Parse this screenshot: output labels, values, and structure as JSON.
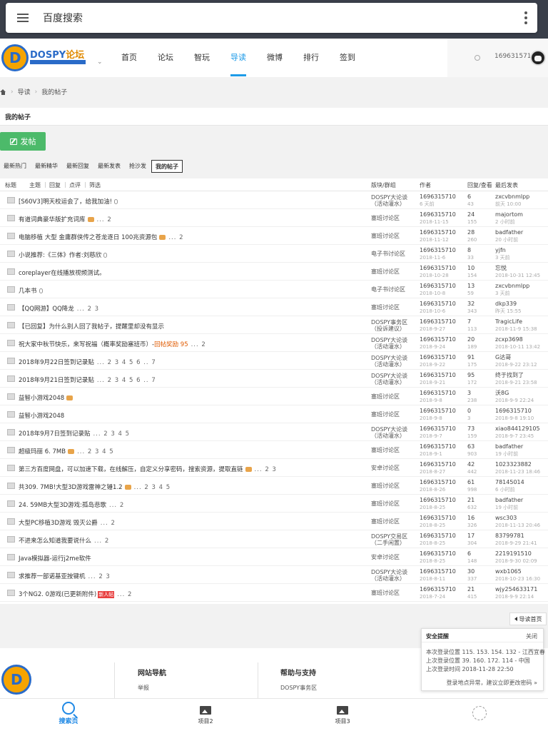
{
  "topbar": {
    "title": "百度搜索"
  },
  "logo": {
    "name": "DOSPY",
    "name_suffix": "论坛"
  },
  "nav": [
    {
      "label": "首页",
      "active": false
    },
    {
      "label": "论坛",
      "active": false
    },
    {
      "label": "智玩",
      "active": false
    },
    {
      "label": "导读",
      "active": true
    },
    {
      "label": "微博",
      "active": false
    },
    {
      "label": "排行",
      "active": false
    },
    {
      "label": "签到",
      "active": false
    }
  ],
  "user": {
    "id": "1696315710"
  },
  "breadcrumb": [
    "导读",
    "我的帖子"
  ],
  "page_title": "我的帖子",
  "post_button": "发帖",
  "tabs": [
    {
      "label": "最新热门",
      "active": false
    },
    {
      "label": "最新精华",
      "active": false
    },
    {
      "label": "最新回复",
      "active": false
    },
    {
      "label": "最新发表",
      "active": false
    },
    {
      "label": "抢沙发",
      "active": false
    },
    {
      "label": "我的帖子",
      "active": true
    }
  ],
  "table": {
    "headers": {
      "title": "标题",
      "filters": [
        "主题",
        "回复",
        "点评",
        "筛选"
      ],
      "forum": "版块/群组",
      "author": "作者",
      "stats": "回复/查看",
      "last": "最后发表"
    },
    "rows": [
      {
        "subject": "[S60V3]明天校运会了，给我加油!",
        "pages": "",
        "forum": "DOSPY大论谈（活动灌水）",
        "author": "1696315710",
        "date": "6 天前",
        "replies": "6",
        "views": "43",
        "last_user": "zxcvbnmlpp",
        "last_time": "前天 10:00"
      },
      {
        "subject": "有道词典豪华版扩充词库",
        "pages": "... 2",
        "forum": "塞班讨论区",
        "author": "1696315710",
        "date": "2018-11-15",
        "replies": "24",
        "views": "155",
        "last_user": "majortom",
        "last_time": "2 小时前"
      },
      {
        "subject": "电脑移植 大型 金庸群侠传之苍龙逐日 100兆资源包",
        "pages": "... 2",
        "forum": "塞班讨论区",
        "author": "1696315710",
        "date": "2018-11-12",
        "replies": "28",
        "views": "260",
        "last_user": "badfather",
        "last_time": "20 小时前"
      },
      {
        "subject": "小说推荐:《三体》作者:刘慈欣",
        "pages": "",
        "forum": "电子书讨论区",
        "author": "1696315710",
        "date": "2018-11-6",
        "replies": "8",
        "views": "33",
        "last_user": "yjfn",
        "last_time": "3 天前"
      },
      {
        "subject": "coreplayer在线播放视频测试。",
        "pages": "",
        "forum": "塞班讨论区",
        "author": "1696315710",
        "date": "2018-10-28",
        "replies": "10",
        "views": "154",
        "last_user": "忘悦",
        "last_time": "2018-10-31 12:45"
      },
      {
        "subject": "几本书",
        "pages": "",
        "forum": "电子书讨论区",
        "author": "1696315710",
        "date": "2018-10-8",
        "replies": "13",
        "views": "59",
        "last_user": "zxcvbnmlpp",
        "last_time": "3 天前"
      },
      {
        "subject": "【QQ网游】QQ降龙",
        "pages": "... 2 3",
        "forum": "塞班讨论区",
        "author": "1696315710",
        "date": "2018-10-6",
        "replies": "32",
        "views": "343",
        "last_user": "dkp339",
        "last_time": "昨天 15:55"
      },
      {
        "subject": "【已回复】为什么别人回了我帖子，提醒里却没有显示",
        "pages": "",
        "forum": "DOSPY事务区（投诉建议）",
        "author": "1696315710",
        "date": "2018-9-27",
        "replies": "7",
        "views": "113",
        "last_user": "TragicLife",
        "last_time": "2018-11-9 15:38"
      },
      {
        "subject": "祝大家中秋节快乐，来写祝福（概率奖励塞班币）-",
        "highlight": "回帖奖励 95",
        "pages": "... 2",
        "forum": "DOSPY大论谈（活动灌水）",
        "author": "1696315710",
        "date": "2018-9-24",
        "replies": "20",
        "views": "189",
        "last_user": "zcxp3698",
        "last_time": "2018-10-11 13:42"
      },
      {
        "subject": "2018年9月22日签到记录贴",
        "pages": "... 2 3 4 5 6 .. 7",
        "forum": "DOSPY大论谈（活动灌水）",
        "author": "1696315710",
        "date": "2018-9-22",
        "replies": "91",
        "views": "175",
        "last_user": "G达哥",
        "last_time": "2018-9-22 23:12"
      },
      {
        "subject": "2018年9月21日签到记录贴",
        "pages": "... 2 3 4 5 6 .. 7",
        "forum": "DOSPY大论谈（活动灌水）",
        "author": "1696315710",
        "date": "2018-9-21",
        "replies": "95",
        "views": "172",
        "last_user": "终于找到了",
        "last_time": "2018-9-21 23:58"
      },
      {
        "subject": "益智小游戏2048",
        "pages": "",
        "forum": "塞班讨论区",
        "author": "1696315710",
        "date": "2018-9-8",
        "replies": "3",
        "views": "238",
        "last_user": "沃8G",
        "last_time": "2018-9-9 22:24"
      },
      {
        "subject": "益智小游戏2048",
        "pages": "",
        "forum": "塞班讨论区",
        "author": "1696315710",
        "date": "2018-9-8",
        "replies": "0",
        "views": "3",
        "last_user": "1696315710",
        "last_time": "2018-9-8 19:10"
      },
      {
        "subject": "2018年9月7日签到记录贴",
        "pages": "... 2 3 4 5",
        "forum": "DOSPY大论谈（活动灌水）",
        "author": "1696315710",
        "date": "2018-9-7",
        "replies": "73",
        "views": "159",
        "last_user": "xiao844129105",
        "last_time": "2018-9-7 23:45"
      },
      {
        "subject": "超级玛丽 6. 7MB",
        "pages": "... 2 3 4 5",
        "forum": "塞班讨论区",
        "author": "1696315710",
        "date": "2018-9-1",
        "replies": "63",
        "views": "903",
        "last_user": "badfather",
        "last_time": "19 小时前"
      },
      {
        "subject": "第三方百度网盘，可以加速下载，在线解压，自定义分享密码，搜索资源，提取直链",
        "pages": "... 2 3",
        "forum": "安卓讨论区",
        "author": "1696315710",
        "date": "2018-8-27",
        "replies": "42",
        "views": "442",
        "last_user": "1023323882",
        "last_time": "2018-11-23 18:46"
      },
      {
        "subject": "共309. 7MB!大型3D游戏雷神之锤1.2",
        "pages": "... 2 3 4 5",
        "forum": "塞班讨论区",
        "author": "1696315710",
        "date": "2018-8-26",
        "replies": "61",
        "views": "998",
        "last_user": "78145014",
        "last_time": "6 小时前"
      },
      {
        "subject": "24. 59MB大型3D游戏:孤岛悲歌",
        "pages": "... 2",
        "forum": "塞班讨论区",
        "author": "1696315710",
        "date": "2018-8-25",
        "replies": "21",
        "views": "632",
        "last_user": "badfather",
        "last_time": "19 小时前"
      },
      {
        "subject": "大型PC移植3D游戏 毁灭公爵",
        "pages": "... 2",
        "forum": "塞班讨论区",
        "author": "1696315710",
        "date": "2018-8-25",
        "replies": "16",
        "views": "326",
        "last_user": "wsc303",
        "last_time": "2018-11-13 20:46"
      },
      {
        "subject": "不进来怎么知道我要说什么",
        "pages": "... 2",
        "forum": "DOSPY交易区（二手闲置）",
        "author": "1696315710",
        "date": "2018-8-25",
        "replies": "17",
        "views": "304",
        "last_user": "83799781",
        "last_time": "2018-9-29 21:41"
      },
      {
        "subject": "Java模拟器-运行j2me软件",
        "pages": "",
        "forum": "安卓讨论区",
        "author": "1696315710",
        "date": "2018-8-25",
        "replies": "6",
        "views": "148",
        "last_user": "2219191510",
        "last_time": "2018-9-30 02:09"
      },
      {
        "subject": "求推荐一部诺基亚按键机",
        "pages": "... 2 3",
        "forum": "DOSPY大论谈（活动灌水）",
        "author": "1696315710",
        "date": "2018-8-11",
        "replies": "30",
        "views": "337",
        "last_user": "wxb1065",
        "last_time": "2018-10-23 16:30"
      },
      {
        "subject": "3个NG2. 0游戏(已更新附件)",
        "badge": "新人帖",
        "pages": "... 2",
        "forum": "塞班讨论区",
        "author": "1696315710",
        "date": "2018-7-24",
        "replies": "21",
        "views": "415",
        "last_user": "wjy254633171",
        "last_time": "2018-9-9 22:14"
      }
    ]
  },
  "back_link": "导读首页",
  "footer": {
    "col1_title": "网站导航",
    "col1_link": "举报",
    "col2_title": "帮助与支持",
    "col2_link": "DOSPY事务区"
  },
  "security": {
    "title": "安全提醒",
    "close": "关闭",
    "line1": "本次登录位置 115. 153. 154. 132 - 江西宜春",
    "line2": "上次登录位置 39. 160. 172. 114 - 中国",
    "line3": "上次登录时间 2018-11-28 22:50",
    "note": "登录地点异常，建议立即更改密码 »"
  },
  "bottom_nav": [
    {
      "label": "搜索页",
      "icon": "search-icon",
      "active": true
    },
    {
      "label": "项目2",
      "icon": "image-icon",
      "active": false
    },
    {
      "label": "项目3",
      "icon": "image-icon",
      "active": false
    }
  ]
}
